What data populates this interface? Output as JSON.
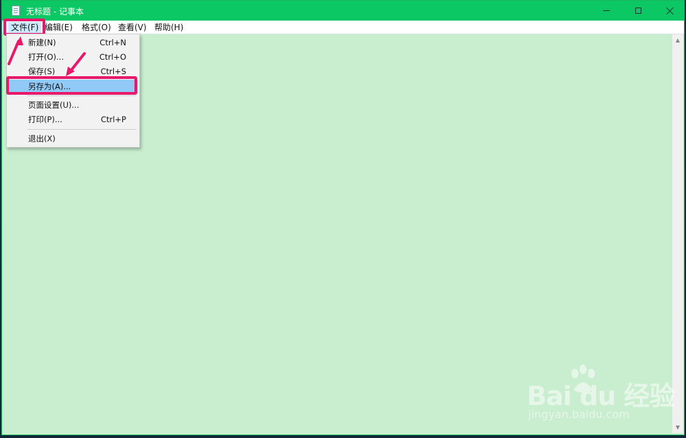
{
  "window": {
    "title": "无标题 - 记事本",
    "colors": {
      "titlebar": "#0cc864",
      "editor_bg": "#c9edcf",
      "highlight": "#e8196a",
      "selected_item": "#91c9f7"
    }
  },
  "menubar": {
    "file": "文件(F)",
    "edit": "编辑(E)",
    "format": "格式(O)",
    "view": "查看(V)",
    "help": "帮助(H)"
  },
  "file_menu": {
    "items": [
      {
        "label": "新建(N)",
        "shortcut": "Ctrl+N"
      },
      {
        "label": "打开(O)...",
        "shortcut": "Ctrl+O"
      },
      {
        "label": "保存(S)",
        "shortcut": "Ctrl+S"
      },
      {
        "label": "另存为(A)...",
        "shortcut": ""
      },
      {
        "label": "页面设置(U)...",
        "shortcut": ""
      },
      {
        "label": "打印(P)...",
        "shortcut": "Ctrl+P"
      },
      {
        "label": "退出(X)",
        "shortcut": ""
      }
    ]
  },
  "watermark": {
    "brand": "Bai du 经验",
    "url": "jingyan.baidu.com"
  }
}
